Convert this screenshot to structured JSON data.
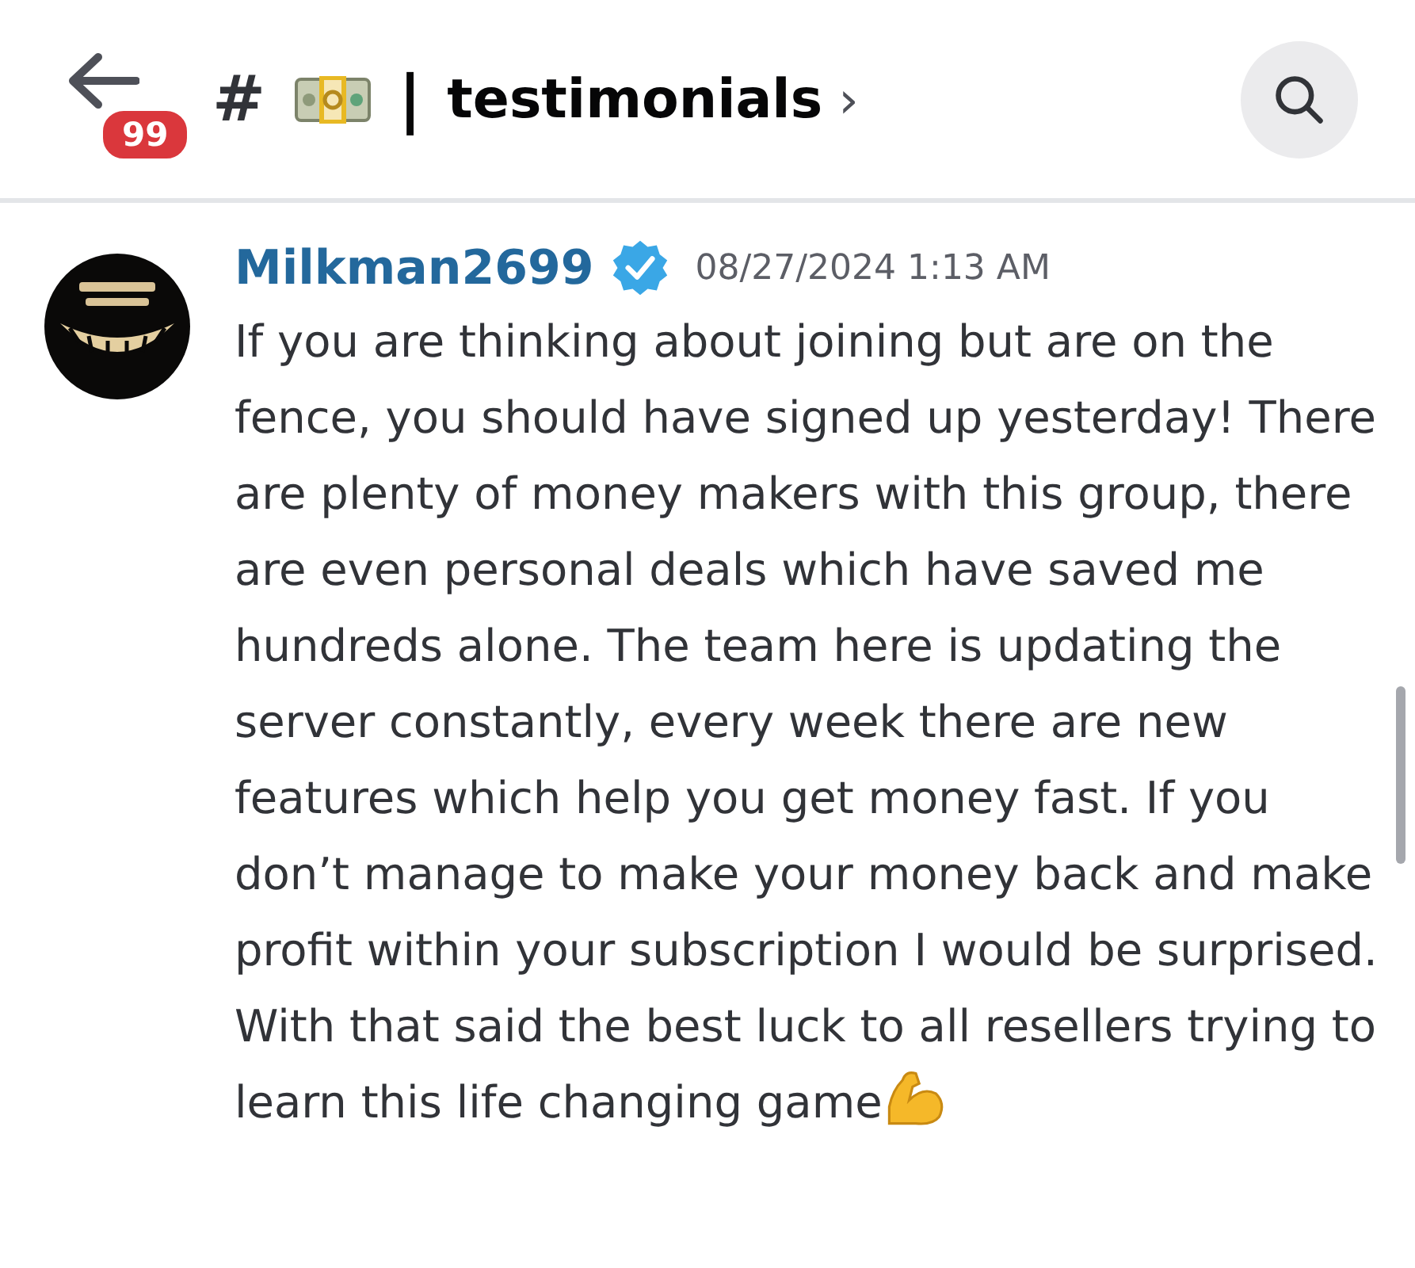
{
  "header": {
    "unread_badge": "99",
    "channel_prefix": "#",
    "separator": "|",
    "channel_name": "testimonials",
    "chevron": "›"
  },
  "messages": [
    {
      "author": "Milkman2699",
      "verified": true,
      "timestamp": "08/27/2024 1:13 AM",
      "text": "If you are thinking about joining but are on the fence, you should have signed up yesterday! There are plenty of money makers with this group, there are even personal deals which have saved me hundreds alone. The team here is updating the server constantly, every week there are new features which help you get money fast. If you don’t manage to make your money back and make profit within your subscription I would be surprised. With that said the best luck to all resellers trying to learn this life changing game"
    }
  ]
}
